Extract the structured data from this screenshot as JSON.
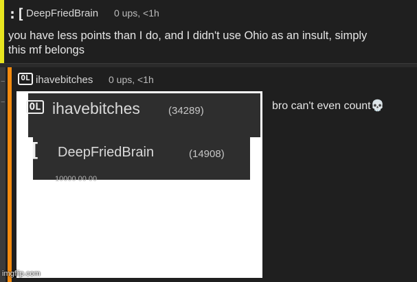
{
  "top_comment": {
    "avatar_glyph": ":[",
    "username": "DeepFriedBrain",
    "meta": "0 ups, <1h",
    "text_line1": "you have less points than I do, and I didn't use Ohio as an insult, simply",
    "text_line2": "this mf belongs",
    "bar_color": "#e8e51f"
  },
  "reply_comment": {
    "avatar_glyph": "OL",
    "username": "ihavebitches",
    "meta": "0 ups, <1h",
    "text": "bro can't even count",
    "skull_icon": "💀",
    "bar_color": "#f28a0e"
  },
  "embedded_image": {
    "card1": {
      "avatar_glyph": "OL",
      "name": "ihavebitches",
      "points": "(34289)"
    },
    "card2": {
      "avatar_glyph": "[",
      "name": "DeepFriedBrain",
      "points": "(14908)",
      "cutoff_text": "10000 00 00"
    }
  },
  "watermark": "imgflip.com",
  "controls": {
    "collapse_top": "−",
    "collapse_mid": "−"
  }
}
